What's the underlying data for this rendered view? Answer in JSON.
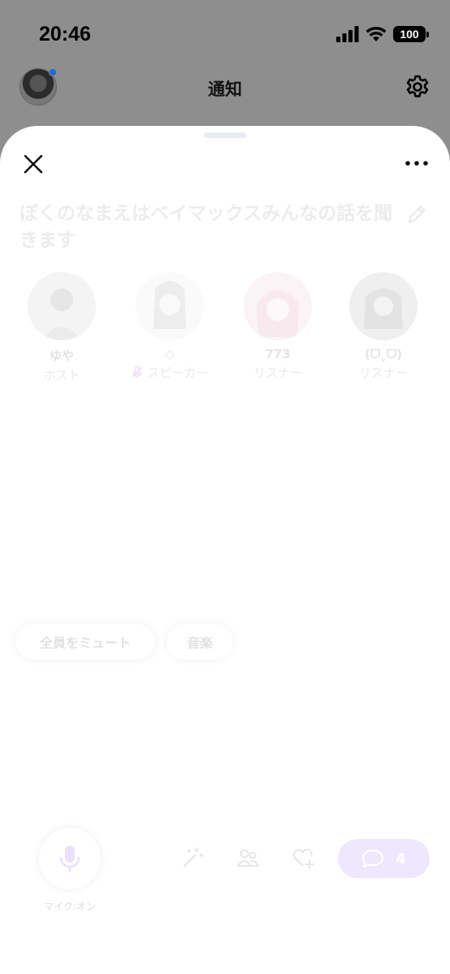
{
  "status_bar": {
    "time": "20:46",
    "battery": "100"
  },
  "header": {
    "title": "通知"
  },
  "room": {
    "title": "ぼくのなまえはベイマックスみんなの話を聞きます"
  },
  "members": [
    {
      "name": "ゆや",
      "role": "ホスト"
    },
    {
      "name": "◇",
      "role": "スピーカー"
    },
    {
      "name": "773",
      "role": "リスナー"
    },
    {
      "name": "(ᗜˬᗜ)",
      "role": "リスナー"
    }
  ],
  "controls": {
    "mute_all": "全員をミュート",
    "music": "音楽",
    "mic_label": "マイク:オン",
    "comment_count": "4"
  },
  "colors": {
    "accent_light": "#efe7fd",
    "avatar_dot": "#1e6ad6"
  }
}
